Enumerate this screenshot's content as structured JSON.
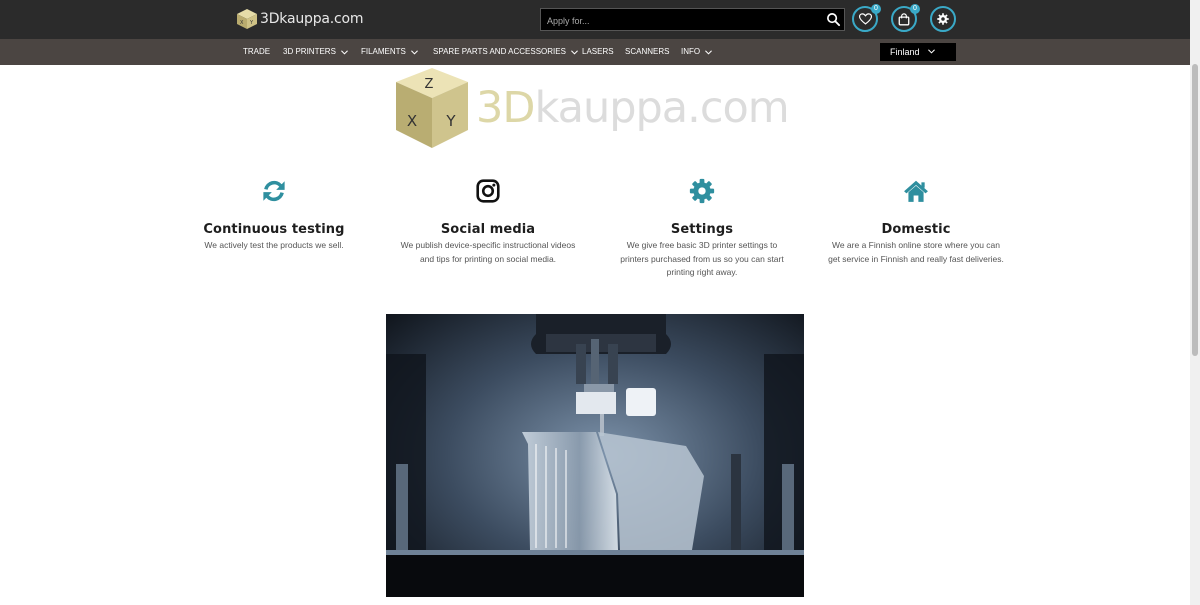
{
  "header": {
    "logo_text": "3Dkauppa.com",
    "search_placeholder": "Apply for...",
    "wishlist_count": "0",
    "cart_count": "0"
  },
  "nav": {
    "items": [
      {
        "label": "TRADE"
      },
      {
        "label": "3D PRINTERS"
      },
      {
        "label": "FILAMENTS"
      },
      {
        "label": "SPARE PARTS AND ACCESSORIES"
      },
      {
        "label": "LASERS"
      },
      {
        "label": "SCANNERS"
      },
      {
        "label": "INFO"
      }
    ],
    "country": "Finland"
  },
  "hero": {
    "brand_3d": "3D",
    "brand_rest": "kauppa.com",
    "cube_letters": [
      "Z",
      "X",
      "Y"
    ]
  },
  "features": [
    {
      "icon": "sync-icon",
      "title": "Continuous testing",
      "desc_lines": [
        "We actively test the products we sell."
      ]
    },
    {
      "icon": "instagram-icon",
      "title": "Social media",
      "desc_lines": [
        "We publish device-specific instructional videos",
        "and tips for printing on social media."
      ]
    },
    {
      "icon": "gear-icon",
      "title": "Settings",
      "desc_lines": [
        "We give free basic 3D printer settings to",
        "printers purchased from us so you can start",
        "printing right away."
      ]
    },
    {
      "icon": "home-icon",
      "title": "Domestic",
      "desc_lines": [
        "We are a Finnish online store where you can",
        "get service in Finnish and really fast deliveries."
      ]
    }
  ],
  "colors": {
    "accent": "#3aa9c7",
    "feature_icon": "#2f8f9f",
    "topbar": "#2b2b2b",
    "navbar": "#4b4542"
  }
}
